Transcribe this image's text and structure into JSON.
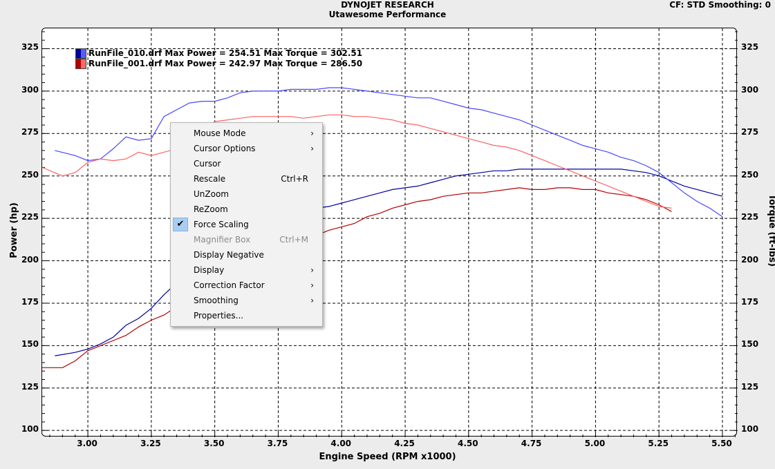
{
  "header": {
    "title": "DYNOJET RESEARCH",
    "subtitle": "Utawesome Performance",
    "cf_info": "CF: STD  Smoothing: 0"
  },
  "axes": {
    "ylabel_left": "Power (hp)",
    "ylabel_right": "Torque (ft-lbs)",
    "xlabel": "Engine Speed (RPM x1000)",
    "y_ticks": [
      "100",
      "125",
      "150",
      "175",
      "200",
      "225",
      "250",
      "275",
      "300",
      "325"
    ],
    "x_ticks": [
      "3.00",
      "3.25",
      "3.50",
      "3.75",
      "4.00",
      "4.25",
      "4.50",
      "4.75",
      "5.00",
      "5.25",
      "5.50"
    ]
  },
  "legend": [
    {
      "text": "RunFile_010.drf Max Power = 254.51 Max Torque = 302.51",
      "color_dark": "#00009c",
      "color_light": "#5a5aff"
    },
    {
      "text": "RunFile_001.drf Max Power = 242.97 Max Torque = 286.50",
      "color_dark": "#b00000",
      "color_light": "#ff6a6a"
    }
  ],
  "context_menu": {
    "items": [
      {
        "label": "Mouse Mode",
        "submenu": true
      },
      {
        "label": "Cursor Options",
        "submenu": true
      },
      {
        "label": "Cursor"
      },
      {
        "label": "Rescale",
        "shortcut": "Ctrl+R"
      },
      {
        "label": "UnZoom"
      },
      {
        "label": "ReZoom"
      },
      {
        "label": "Force Scaling",
        "checked": true
      },
      {
        "label": "Magnifier Box",
        "shortcut": "Ctrl+M",
        "disabled": true
      },
      {
        "label": "Display Negative"
      },
      {
        "label": "Display",
        "submenu": true
      },
      {
        "label": "Correction Factor",
        "submenu": true
      },
      {
        "label": "Smoothing",
        "submenu": true
      },
      {
        "label": "Properties..."
      }
    ]
  },
  "chart_data": {
    "type": "line",
    "xlabel": "Engine Speed (RPM x1000)",
    "ylabel": "Power (hp)",
    "ylabel_right": "Torque (ft-lbs)",
    "xlim": [
      2.82,
      5.56
    ],
    "ylim": [
      96,
      337
    ],
    "grid": true,
    "series": [
      {
        "name": "RunFile_010.drf",
        "measure": "power",
        "color": "#00009c",
        "x": [
          2.87,
          2.95,
          3.0,
          3.05,
          3.1,
          3.15,
          3.2,
          3.25,
          3.3,
          3.35,
          3.4,
          3.45,
          3.5,
          3.55,
          3.6,
          3.65,
          3.7,
          3.75,
          3.8,
          3.85,
          3.9,
          3.95,
          4.0,
          4.05,
          4.1,
          4.15,
          4.2,
          4.25,
          4.3,
          4.35,
          4.4,
          4.45,
          4.5,
          4.55,
          4.6,
          4.65,
          4.7,
          4.75,
          4.8,
          4.85,
          4.9,
          4.95,
          5.0,
          5.05,
          5.1,
          5.15,
          5.2,
          5.25,
          5.3,
          5.35,
          5.4,
          5.45,
          5.5
        ],
        "y": [
          144,
          146,
          148,
          151,
          155,
          162,
          166,
          172,
          180,
          187,
          194,
          202,
          208,
          212,
          216,
          219,
          222,
          225,
          227,
          229,
          231,
          232,
          234,
          236,
          238,
          240,
          242,
          243,
          244,
          246,
          248,
          250,
          251,
          252,
          253,
          253,
          254,
          254,
          254,
          254,
          254,
          254,
          254,
          254,
          254,
          253,
          252,
          250,
          247,
          244,
          242,
          240,
          238
        ]
      },
      {
        "name": "RunFile_001.drf",
        "measure": "power",
        "color": "#b00000",
        "x": [
          2.82,
          2.9,
          2.95,
          3.0,
          3.05,
          3.1,
          3.15,
          3.2,
          3.25,
          3.3,
          3.35,
          3.4,
          3.45,
          3.5,
          3.55,
          3.6,
          3.65,
          3.7,
          3.75,
          3.8,
          3.85,
          3.9,
          3.95,
          4.0,
          4.05,
          4.1,
          4.15,
          4.2,
          4.25,
          4.3,
          4.35,
          4.4,
          4.45,
          4.5,
          4.55,
          4.6,
          4.65,
          4.7,
          4.75,
          4.8,
          4.85,
          4.9,
          4.95,
          5.0,
          5.05,
          5.1,
          5.15,
          5.2,
          5.25,
          5.3
        ],
        "y": [
          137,
          137,
          141,
          147,
          150,
          153,
          156,
          161,
          165,
          168,
          173,
          178,
          183,
          188,
          192,
          196,
          199,
          203,
          206,
          209,
          212,
          215,
          218,
          220,
          222,
          226,
          228,
          231,
          233,
          235,
          236,
          238,
          239,
          240,
          240,
          241,
          242,
          243,
          242,
          242,
          243,
          243,
          242,
          242,
          240,
          239,
          238,
          236,
          233,
          229
        ]
      },
      {
        "name": "RunFile_010.drf",
        "measure": "torque",
        "color": "#4646ff",
        "x": [
          2.87,
          2.95,
          3.0,
          3.05,
          3.1,
          3.15,
          3.2,
          3.25,
          3.3,
          3.35,
          3.4,
          3.45,
          3.5,
          3.55,
          3.6,
          3.65,
          3.7,
          3.75,
          3.8,
          3.85,
          3.9,
          3.95,
          4.0,
          4.05,
          4.1,
          4.15,
          4.2,
          4.25,
          4.3,
          4.35,
          4.4,
          4.45,
          4.5,
          4.55,
          4.6,
          4.65,
          4.7,
          4.75,
          4.8,
          4.85,
          4.9,
          4.95,
          5.0,
          5.05,
          5.1,
          5.15,
          5.2,
          5.25,
          5.3,
          5.35,
          5.4,
          5.45,
          5.5
        ],
        "y": [
          265,
          262,
          259,
          260,
          266,
          273,
          271,
          272,
          285,
          289,
          293,
          294,
          294,
          296,
          299,
          300,
          300,
          300,
          301,
          301,
          301,
          302,
          302,
          301,
          300,
          299,
          298,
          297,
          296,
          296,
          294,
          292,
          290,
          289,
          287,
          285,
          283,
          280,
          277,
          274,
          271,
          268,
          266,
          264,
          261,
          259,
          256,
          252,
          246,
          240,
          235,
          231,
          226
        ]
      },
      {
        "name": "RunFile_001.drf",
        "measure": "torque",
        "color": "#ff6060",
        "x": [
          2.82,
          2.9,
          2.95,
          3.0,
          3.05,
          3.1,
          3.15,
          3.2,
          3.25,
          3.3,
          3.35,
          3.4,
          3.45,
          3.5,
          3.55,
          3.6,
          3.65,
          3.7,
          3.75,
          3.8,
          3.85,
          3.9,
          3.95,
          4.0,
          4.05,
          4.1,
          4.15,
          4.2,
          4.25,
          4.3,
          4.35,
          4.4,
          4.45,
          4.5,
          4.55,
          4.6,
          4.65,
          4.7,
          4.75,
          4.8,
          4.85,
          4.9,
          4.95,
          5.0,
          5.05,
          5.1,
          5.15,
          5.2,
          5.25,
          5.3
        ],
        "y": [
          255,
          250,
          252,
          258,
          260,
          259,
          260,
          264,
          262,
          264,
          266,
          272,
          278,
          282,
          283,
          284,
          285,
          285,
          285,
          285,
          284,
          285,
          286,
          286,
          285,
          285,
          284,
          283,
          281,
          280,
          278,
          276,
          274,
          272,
          270,
          268,
          267,
          265,
          262,
          259,
          256,
          253,
          250,
          247,
          244,
          241,
          238,
          235,
          232,
          231
        ]
      }
    ]
  }
}
